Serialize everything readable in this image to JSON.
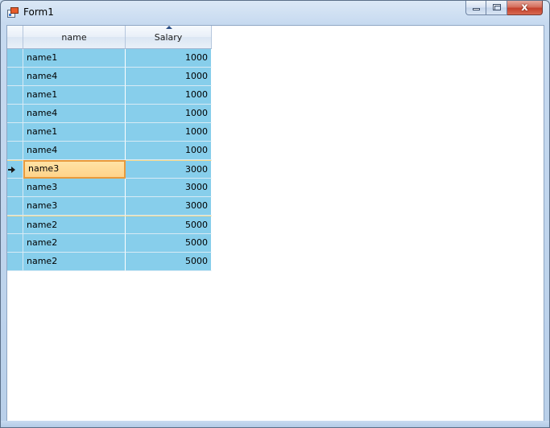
{
  "window": {
    "title": "Form1",
    "minimize_label": "",
    "maximize_label": "",
    "close_label": "x"
  },
  "grid": {
    "columns": [
      {
        "header": "name",
        "align": "left"
      },
      {
        "header": "Salary",
        "align": "right",
        "sorted": "ascending"
      }
    ],
    "current_row": 6,
    "rows": [
      {
        "name": "name1",
        "salary": "1000"
      },
      {
        "name": "name4",
        "salary": "1000"
      },
      {
        "name": "name1",
        "salary": "1000"
      },
      {
        "name": "name4",
        "salary": "1000"
      },
      {
        "name": "name1",
        "salary": "1000"
      },
      {
        "name": "name4",
        "salary": "1000"
      },
      {
        "name": "name3",
        "salary": "3000"
      },
      {
        "name": "name3",
        "salary": "3000"
      },
      {
        "name": "name3",
        "salary": "3000"
      },
      {
        "name": "name2",
        "salary": "5000"
      },
      {
        "name": "name2",
        "salary": "5000"
      },
      {
        "name": "name2",
        "salary": "5000"
      }
    ],
    "row_color": "#87ceeb",
    "current_cell_color": "#ffd38a"
  }
}
